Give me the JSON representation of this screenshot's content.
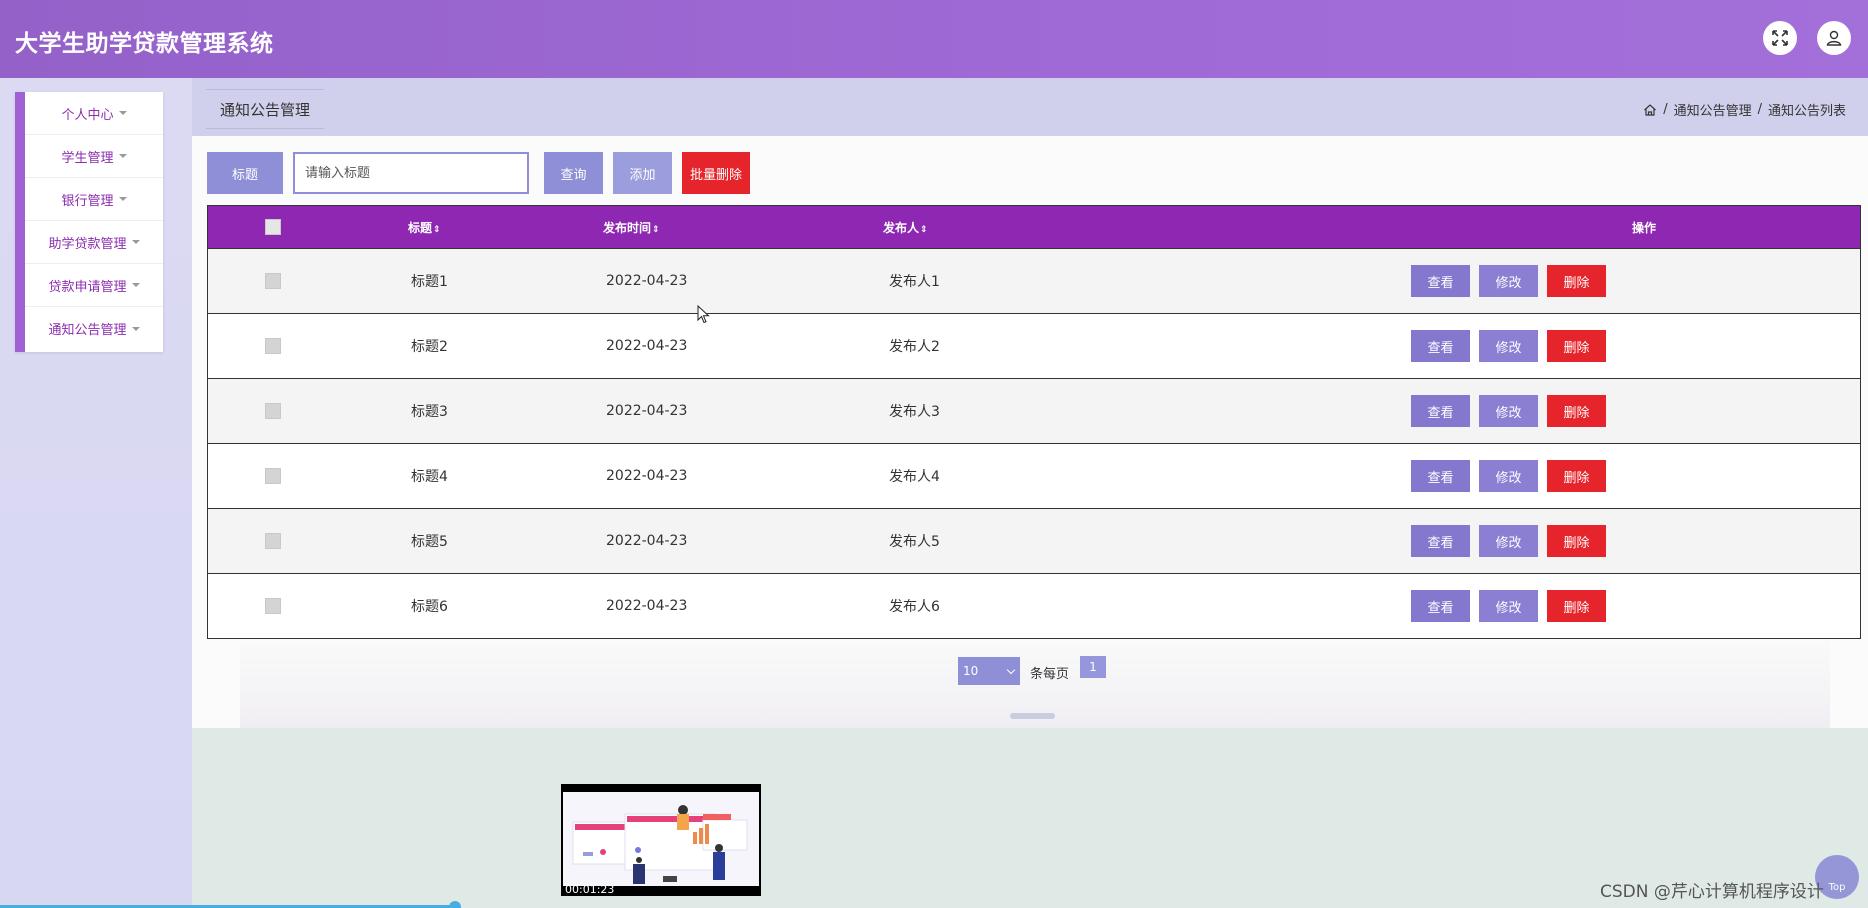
{
  "header": {
    "app_title": "大学生助学贷款管理系统",
    "icons": {
      "fullscreen": "expand-icon",
      "user": "user-icon"
    }
  },
  "sidebar": {
    "items": [
      {
        "label": "个人中心"
      },
      {
        "label": "学生管理"
      },
      {
        "label": "银行管理"
      },
      {
        "label": "助学贷款管理"
      },
      {
        "label": "贷款申请管理"
      },
      {
        "label": "通知公告管理"
      }
    ]
  },
  "page": {
    "tab_title": "通知公告管理",
    "breadcrumb": {
      "home_icon": "home-icon",
      "level1": "通知公告管理",
      "level2": "通知公告列表",
      "separator": "/"
    }
  },
  "search": {
    "label": "标题",
    "placeholder": "请输入标题",
    "value": "",
    "query_label": "查询",
    "add_label": "添加",
    "batch_delete_label": "批量删除"
  },
  "table": {
    "columns": [
      "标题",
      "发布时间",
      "发布人",
      "操作"
    ],
    "sort_icon": "⇕",
    "rows": [
      {
        "title": "标题1",
        "time": "2022-04-23",
        "publisher": "发布人1"
      },
      {
        "title": "标题2",
        "time": "2022-04-23",
        "publisher": "发布人2"
      },
      {
        "title": "标题3",
        "time": "2022-04-23",
        "publisher": "发布人3"
      },
      {
        "title": "标题4",
        "time": "2022-04-23",
        "publisher": "发布人4"
      },
      {
        "title": "标题5",
        "time": "2022-04-23",
        "publisher": "发布人5"
      },
      {
        "title": "标题6",
        "time": "2022-04-23",
        "publisher": "发布人6"
      }
    ],
    "actions": {
      "view": "查看",
      "edit": "修改",
      "delete": "删除"
    }
  },
  "pagination": {
    "page_size": "10",
    "per_page_label": "条每页",
    "current_page": "1"
  },
  "video": {
    "timestamp": "00:01:23"
  },
  "top_button": "Top",
  "watermark": "CSDN @芹心计算机程序设计",
  "colors": {
    "header": "#9a65cf",
    "table_header": "#8e28b2",
    "button": "#8e8fd6",
    "danger": "#e5252b",
    "sidebar_accent": "#a160d4"
  }
}
